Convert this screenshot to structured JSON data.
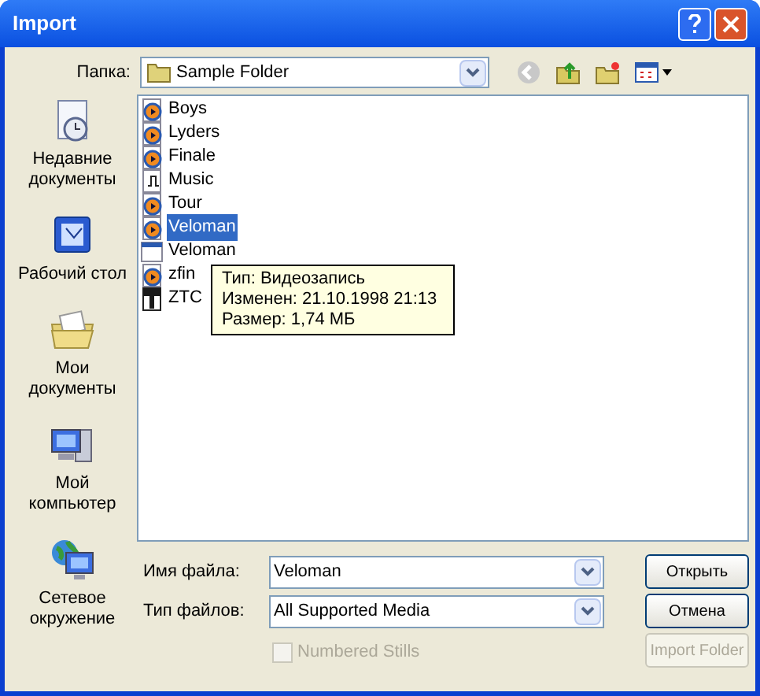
{
  "window": {
    "title": "Import"
  },
  "folder": {
    "label": "Папка:",
    "value": "Sample Folder"
  },
  "places": [
    {
      "label": "Недавние документы",
      "kind": "recent"
    },
    {
      "label": "Рабочий стол",
      "kind": "desktop"
    },
    {
      "label": "Мои документы",
      "kind": "documents"
    },
    {
      "label": "Мой компьютер",
      "kind": "computer"
    },
    {
      "label": "Сетевое окружение",
      "kind": "network"
    }
  ],
  "files": [
    {
      "name": "Boys",
      "kind": "video",
      "selected": false
    },
    {
      "name": "Lyders",
      "kind": "video",
      "selected": false
    },
    {
      "name": "Finale",
      "kind": "video",
      "selected": false
    },
    {
      "name": "Music",
      "kind": "audio",
      "selected": false
    },
    {
      "name": "Tour",
      "kind": "video",
      "selected": false
    },
    {
      "name": "Veloman",
      "kind": "video",
      "selected": true
    },
    {
      "name": "Veloman",
      "kind": "document",
      "selected": false
    },
    {
      "name": "zfin",
      "kind": "video",
      "selected": false
    },
    {
      "name": "ZTC",
      "kind": "archive",
      "selected": false
    }
  ],
  "tooltip": [
    "Тип: Видеозапись",
    "Изменен: 21.10.1998 21:13",
    "Размер: 1,74 МБ"
  ],
  "file_name": {
    "label": "Имя файла:",
    "value": "Veloman"
  },
  "file_type": {
    "label": "Тип файлов:",
    "value": "All Supported Media"
  },
  "buttons": [
    {
      "label": "Открыть",
      "disabled": false
    },
    {
      "label": "Отмена",
      "disabled": false
    },
    {
      "label": "Import Folder",
      "disabled": true
    }
  ],
  "numbered_stills": {
    "label": "Numbered Stills",
    "checked": false,
    "disabled": true
  }
}
